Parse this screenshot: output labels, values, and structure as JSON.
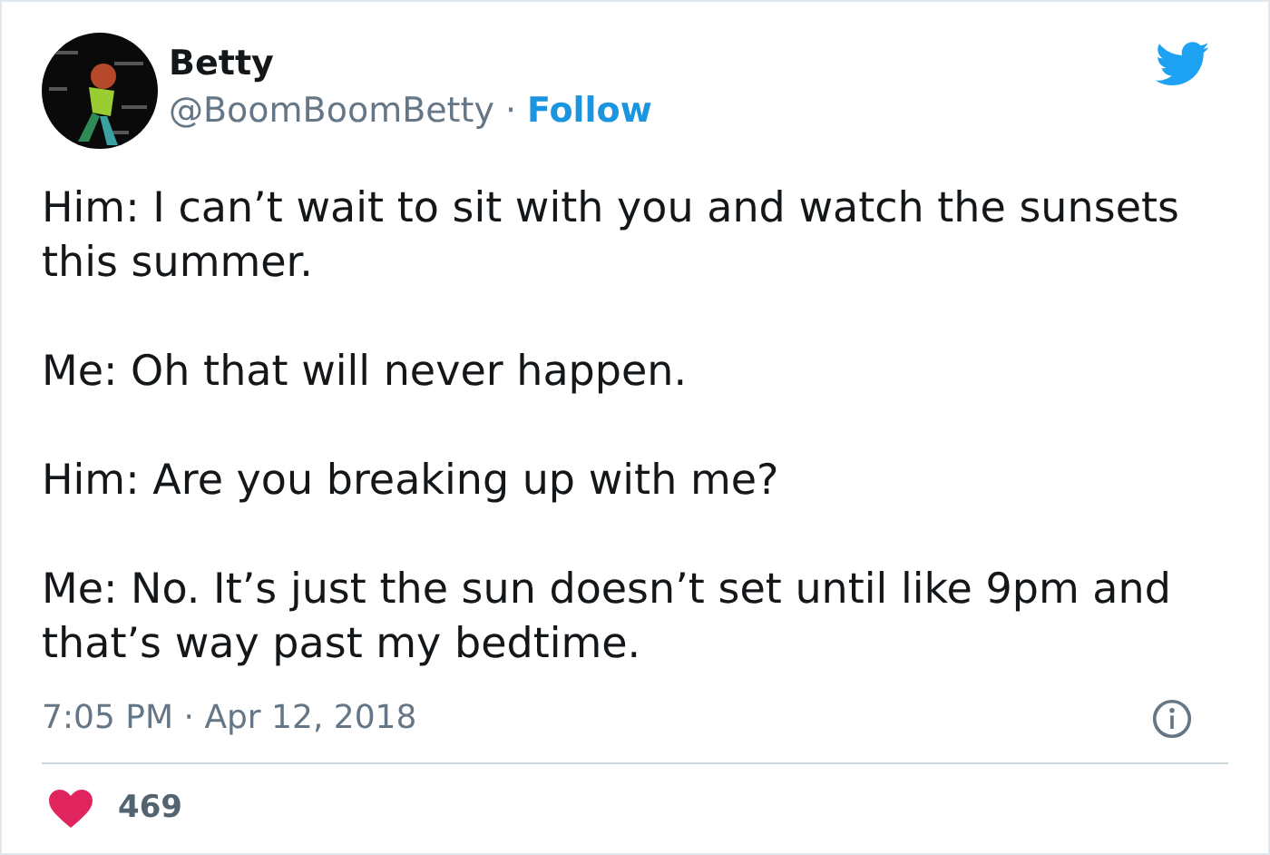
{
  "author": {
    "name": "Betty",
    "handle": "@BoomBoomBetty",
    "separator": "·",
    "follow": "Follow"
  },
  "paragraphs": [
    "Him: I can’t wait to sit with you and watch the sunsets this summer.",
    "Me: Oh that will never happen.",
    "Him: Are you breaking up with me?",
    "Me: No. It’s just the sun doesn’t set until like 9pm and that’s way past my bedtime."
  ],
  "timestamp": "7:05 PM · Apr 12, 2018",
  "likes": {
    "count": "469"
  }
}
